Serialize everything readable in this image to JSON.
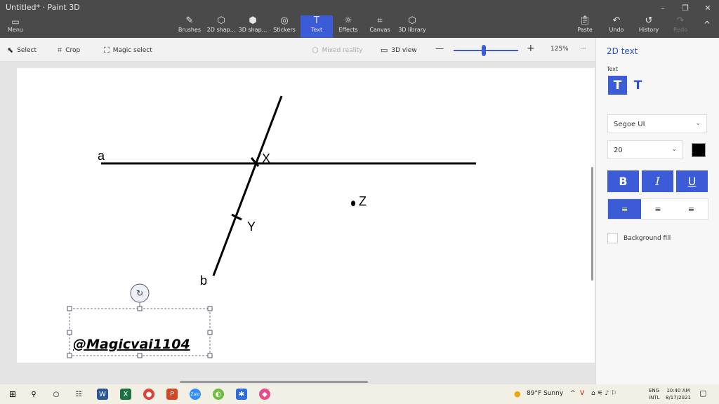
{
  "window": {
    "title": "Untitled* · Paint 3D",
    "minimize": "–",
    "restore": "❐",
    "close": "✕"
  },
  "menu": {
    "label": "Menu",
    "icon": "menu-icon"
  },
  "ribbon": {
    "tools": [
      {
        "label": "Brushes",
        "icon": "brush-icon"
      },
      {
        "label": "2D shap...",
        "icon": "2d-shapes-icon"
      },
      {
        "label": "3D shap...",
        "icon": "3d-shapes-icon"
      },
      {
        "label": "Stickers",
        "icon": "sticker-icon"
      },
      {
        "label": "Text",
        "icon": "text-icon",
        "active": true
      },
      {
        "label": "Effects",
        "icon": "effects-icon"
      },
      {
        "label": "Canvas",
        "icon": "canvas-icon"
      },
      {
        "label": "3D library",
        "icon": "library-icon"
      }
    ],
    "right": [
      {
        "label": "Paste",
        "icon": "paste-icon"
      },
      {
        "label": "Undo",
        "icon": "undo-icon"
      },
      {
        "label": "History",
        "icon": "history-icon"
      },
      {
        "label": "Redo",
        "icon": "redo-icon",
        "disabled": true
      }
    ],
    "collapse": "^"
  },
  "toolbar": {
    "select": "Select",
    "crop": "Crop",
    "magic_select": "Magic select",
    "mixed_reality": "Mixed reality",
    "view_3d": "3D view",
    "zoom_minus": "—",
    "zoom_plus": "+",
    "zoom_level": "125%",
    "more": "···",
    "zoom_fraction": 0.47
  },
  "drawing": {
    "labels": {
      "a": "a",
      "b": "b",
      "x": "X",
      "y": "Y",
      "z": "Z"
    },
    "watermark": "@Magicvai1104"
  },
  "panel": {
    "title": "2D text",
    "text_label": "Text",
    "font": "Segoe UI",
    "size": "20",
    "text_color": "#000000",
    "bold": "B",
    "italic": "I",
    "underline": "U",
    "align_left": "≡",
    "align_center": "≡",
    "align_right": "≡",
    "background_fill": "Background fill"
  },
  "taskbar": {
    "weather": "89°F  Sunny",
    "lang1": "ENG",
    "lang2": "INTL",
    "time": "10:40 AM",
    "date": "8/17/2021"
  },
  "colors": {
    "accent": "#3c5bd6",
    "titlebar": "#4a4a4a"
  }
}
